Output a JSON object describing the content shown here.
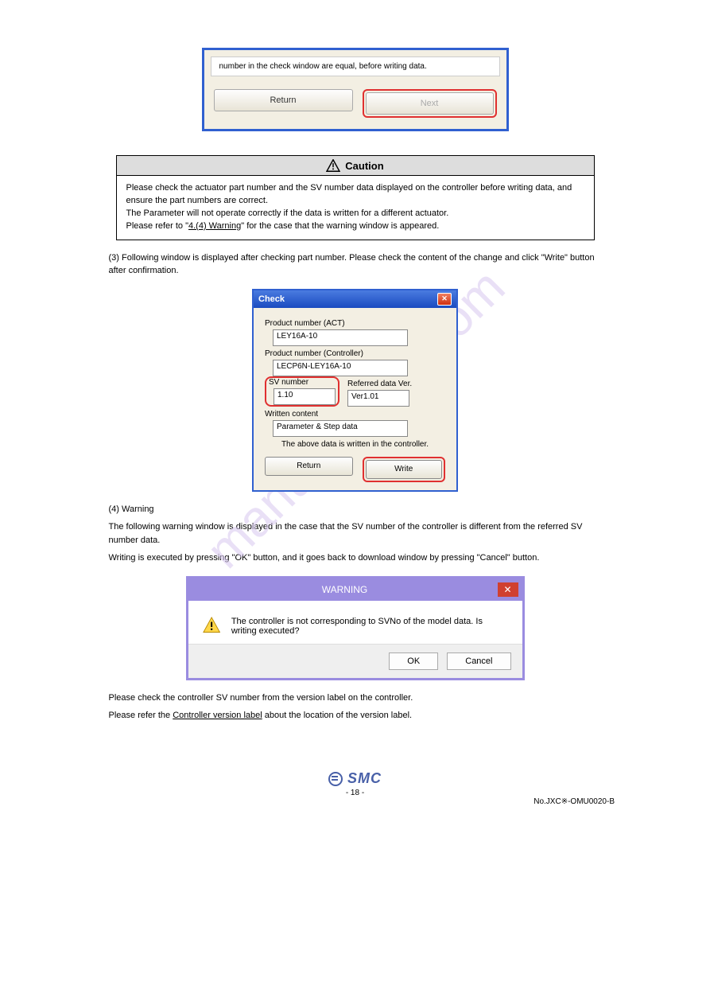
{
  "dialog1": {
    "text": "number in the  check window are equal, before writing data.",
    "return": "Return",
    "next": "Next"
  },
  "caution": {
    "title": "Caution",
    "line1": "Please check the actuator part number and the SV number data displayed on the controller before writing data, and ensure the part numbers are correct.",
    "line2": "The Parameter will not operate correctly if the data is written for a different actuator.",
    "line3": "Please refer to \"",
    "link": "4.(4) Warning",
    "line3b": "\" for the case that the warning window is appeared."
  },
  "para1": "(3) Following window is displayed after checking part number. Please check the content of the change and click \"Write\" button after confirmation.",
  "check": {
    "title": "Check",
    "labAct": "Product number (ACT)",
    "valAct": "LEY16A-10",
    "labCtrl": "Product number (Controller)",
    "valCtrl": "LECP6N-LEY16A-10",
    "labSV": "SV number",
    "valSV": "1.10",
    "labRef": "Referred data Ver.",
    "valRef": "Ver1.01",
    "labWC": "Written content",
    "valWC": "Parameter & Step data",
    "note": "The above data is written in the controller.",
    "return": "Return",
    "write": "Write"
  },
  "para2": "(4) Warning",
  "para2b": "The following warning window is displayed in the case that the SV number of the controller is different from the referred SV number data.",
  "para2c": "Writing is executed by pressing \"OK\" button, and it goes back to download window by pressing \"Cancel\" button.",
  "warn": {
    "title": "WARNING",
    "msg": "The controller is not corresponding to SVNo of the model data. Is writing executed?",
    "ok": "OK",
    "cancel": "Cancel"
  },
  "para3": "Please check the controller SV number from the version label on the controller.",
  "para3b": "Please refer the ",
  "para3link": "Controller version label",
  "para3c": " about the location of the version label.",
  "footer": {
    "logo": "SMC",
    "page": "- 18 -",
    "no": "No.JXC※-OMU0020-B"
  },
  "watermark": "manualshive.com"
}
